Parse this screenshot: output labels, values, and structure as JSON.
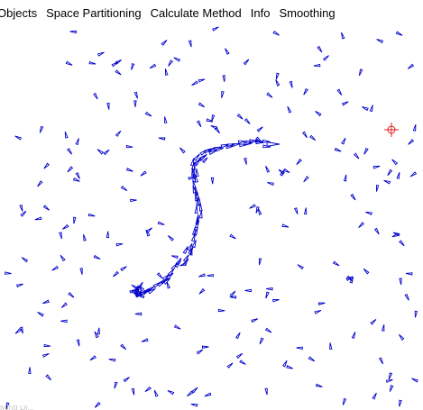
{
  "menubar": {
    "items": [
      {
        "label": "Objects"
      },
      {
        "label": "Space Partitioning"
      },
      {
        "label": "Calculate Method"
      },
      {
        "label": "Info"
      },
      {
        "label": "Smoothing"
      }
    ]
  },
  "colors": {
    "agent": "#0000cc",
    "target": "#e02020",
    "background": "#ffffff"
  },
  "icons": {
    "agent": "triangle-outline-icon",
    "target": "crosshair-icon"
  },
  "bottom_text": "Mind Dl..."
}
